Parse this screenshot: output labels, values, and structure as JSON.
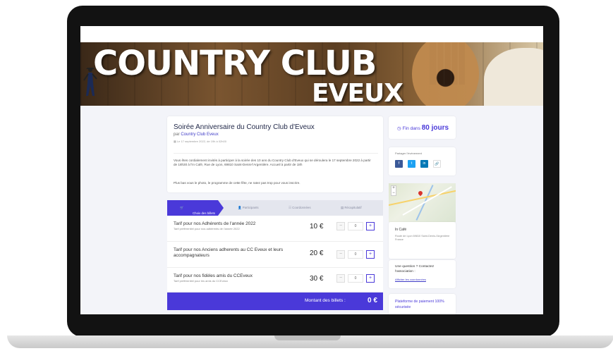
{
  "banner": {
    "title_line1": "COUNTRY CLUB",
    "title_line2": "EVEUX"
  },
  "event": {
    "title": "Soirée Anniversaire du Country Club d'Eveux",
    "organizer_prefix": "par",
    "organizer": "Country Club Eveux",
    "date": "Le 17 septembre 2022, de 19h à 02h00",
    "description": "Vous êtes cordialement invités à participer à la soirée des 10 ans du Country Club d'Eveux qui se déroulera le 17 septembre 2022 à partir de 18h30 à l'In Café, Rue de Lyon, 69810 Saint-Denis-l'Argentière. Accueil à partir de 18h",
    "description2": "Plus bas vous le photo, le programme de cette fête, ne ratez pas trop pour vous inscrire."
  },
  "tabs": [
    {
      "label": "Choix des billets",
      "active": true
    },
    {
      "label": "Participants",
      "active": false
    },
    {
      "label": "Coordonnées",
      "active": false
    },
    {
      "label": "Récapitulatif",
      "active": false
    }
  ],
  "tickets": [
    {
      "name": "Tarif pour nos Adhérents de l'année 2022",
      "sub": "Tarif préférentiel pour nos adhérents de l'année 2022",
      "price": "10 €",
      "qty": "0"
    },
    {
      "name": "Tarif pour nos Anciens adherents au CC Eveux et leurs accompagnateurs",
      "sub": "",
      "price": "20 €",
      "qty": "0"
    },
    {
      "name": "Tarif pour nos fidèles amis du CCEveux",
      "sub": "Tarif préférentiel pour les amis du CCEveux",
      "price": "30 €",
      "qty": "0"
    }
  ],
  "total": {
    "label": "Montant des billets :",
    "value": "0 €"
  },
  "sidebar": {
    "countdown_prefix": "Fin dans",
    "countdown_value": "80 jours",
    "share_label": "Partager l'événement",
    "share_buttons": [
      {
        "icon": "facebook-icon",
        "glyph": "f",
        "color": "#3b5998"
      },
      {
        "icon": "twitter-icon",
        "glyph": "t",
        "color": "#1da1f2"
      },
      {
        "icon": "linkedin-icon",
        "glyph": "in",
        "color": "#0077b5"
      },
      {
        "icon": "link-icon",
        "glyph": "🔗",
        "color": "#ffffff"
      }
    ],
    "venue_name": "In Café",
    "venue_address": "Route de Lyon 69810 Saint-Denis-l'Argentière France",
    "question_title": "Une question ? Contactez l'association :",
    "question_link": "Afficher les coordonnées",
    "payment_title": "Plateforme de paiement 100% sécurisée"
  },
  "colors": {
    "accent": "#4a39d9",
    "background": "#f3f4f9"
  }
}
